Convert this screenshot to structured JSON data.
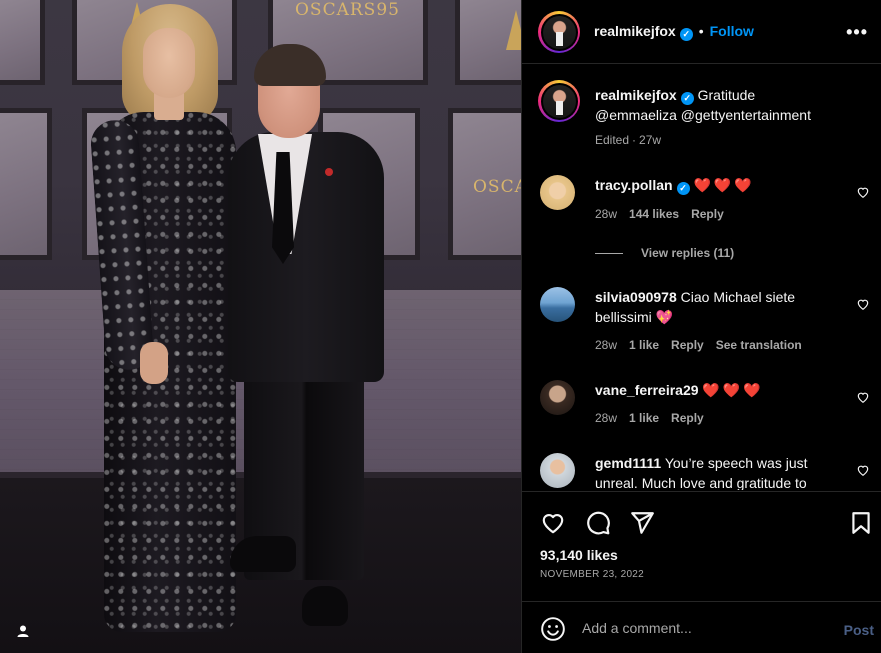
{
  "photo": {
    "backdrop_logo_1": "OSCARS95",
    "backdrop_logo_2": "OSCA"
  },
  "post": {
    "author": "realmikejfox",
    "follow_label": "Follow",
    "more_icon": "more-horizontal-icon",
    "caption_text": "Gratitude",
    "caption_mentions": "@emmaeliza @gettyentertainment",
    "edited_label": "Edited",
    "caption_time": "27w",
    "likes": "93,140 likes",
    "date": "NOVEMBER 23, 2022"
  },
  "comments": [
    {
      "user": "tracy.pollan",
      "verified": true,
      "text": "",
      "hearts": "❤️❤️❤️",
      "time": "28w",
      "likes": "144 likes",
      "reply": "Reply",
      "avatar": "blonde-woman-avatar"
    },
    {
      "user": "silvia090978",
      "verified": false,
      "text": "Ciao Michael siete bellissimi",
      "emoji": "💖",
      "time": "28w",
      "likes": "1 like",
      "reply": "Reply",
      "translate": "See translation",
      "avatar": "beach-avatar"
    },
    {
      "user": "vane_ferreira29",
      "verified": false,
      "text": "",
      "hearts": "❤️❤️❤️",
      "time": "28w",
      "likes": "1 like",
      "reply": "Reply",
      "avatar": "woman-portrait-avatar"
    },
    {
      "user": "gemd1111",
      "verified": false,
      "text": "You’re speech was just unreal. Much love and gratitude to",
      "avatar": "cartoon-avatar"
    }
  ],
  "view_replies": "View replies (11)",
  "add_comment": {
    "placeholder": "Add a comment...",
    "post_label": "Post"
  },
  "colors": {
    "accent": "#0095f6",
    "heart": "#ff3040",
    "background": "#000000",
    "muted_text": "#a8a8a8"
  }
}
